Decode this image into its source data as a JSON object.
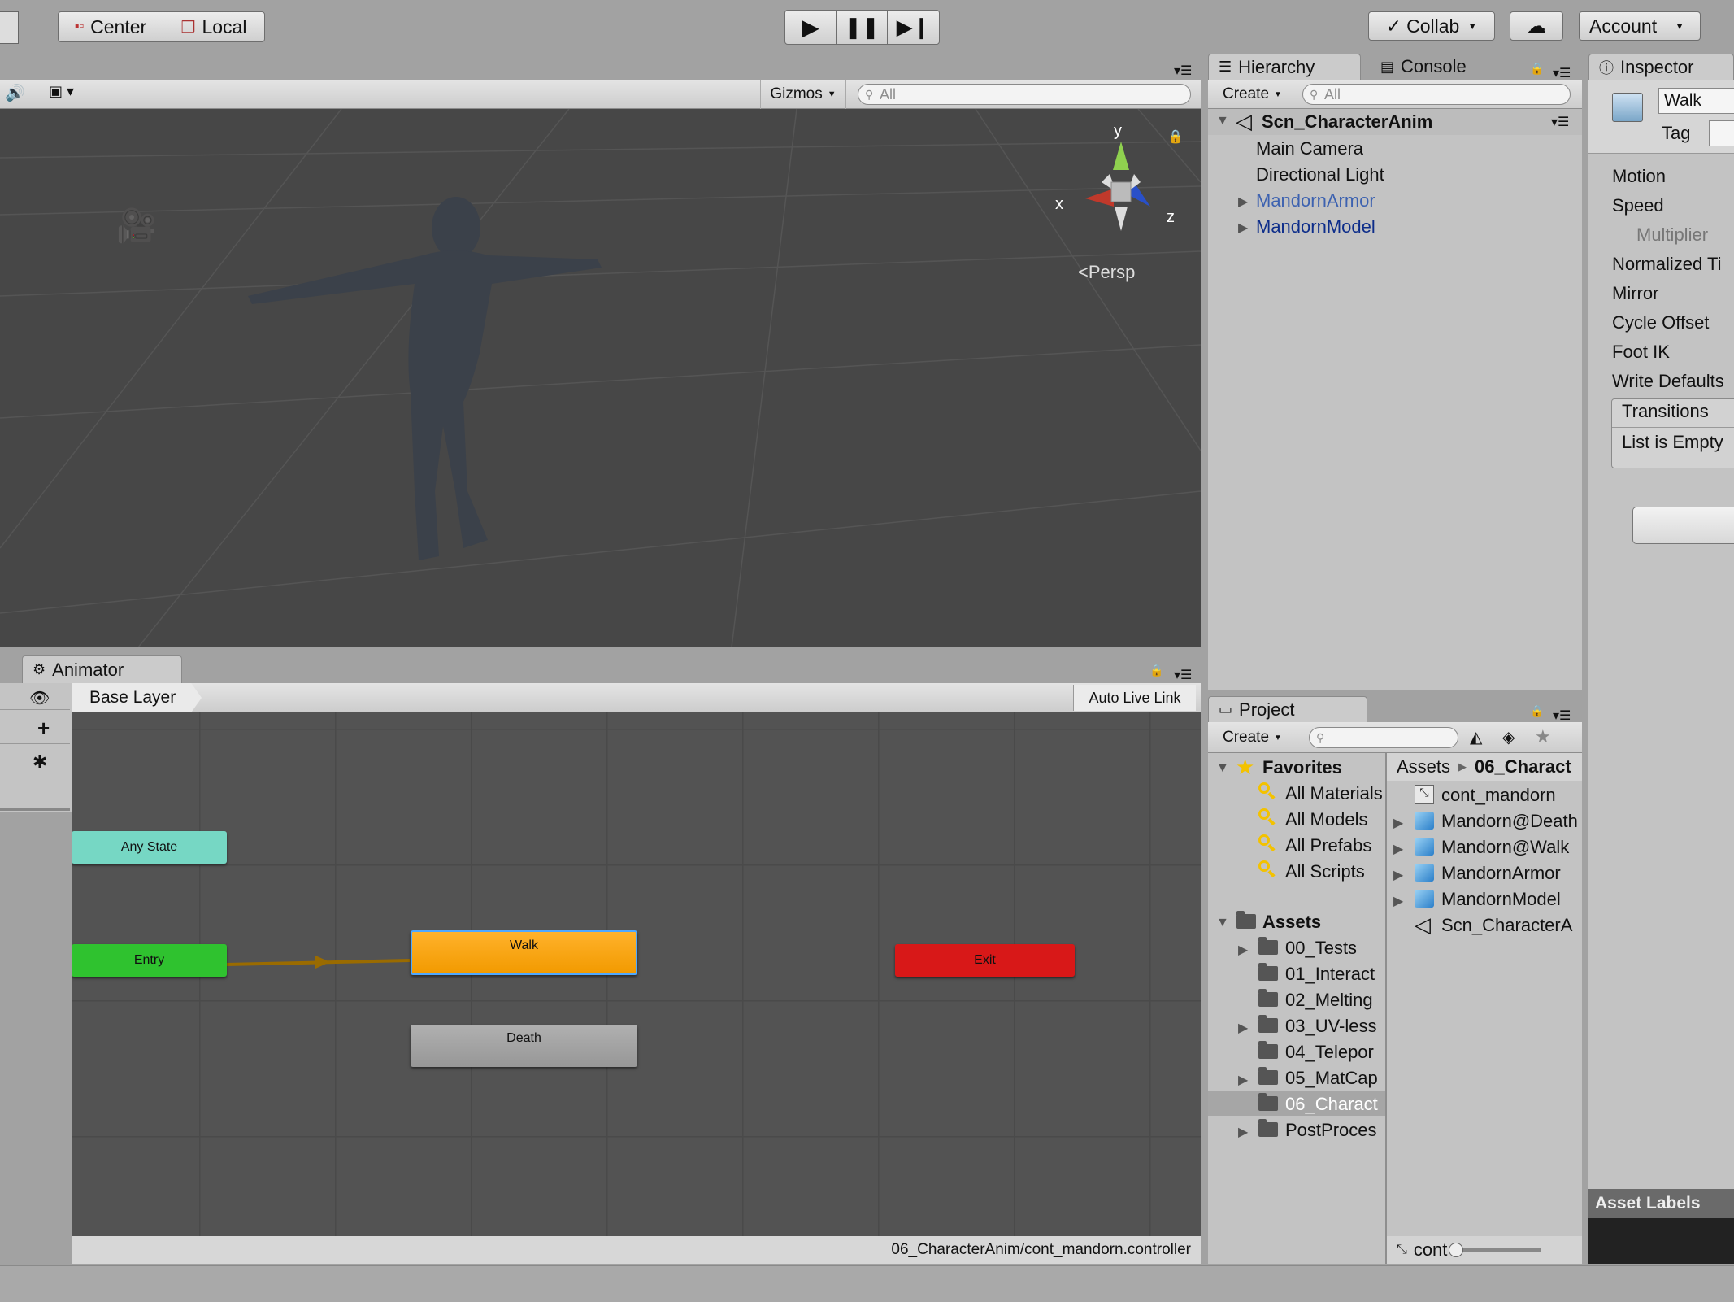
{
  "toolbar": {
    "center_label": "Center",
    "local_label": "Local",
    "collab_label": "Collab",
    "account_label": "Account"
  },
  "scene": {
    "gizmos_label": "Gizmos",
    "search_placeholder": "All",
    "persp_label": "Persp",
    "axis_x": "x",
    "axis_y": "y",
    "axis_z": "z"
  },
  "hierarchy": {
    "tab_label": "Hierarchy",
    "console_tab": "Console",
    "create_label": "Create",
    "search_placeholder": "All",
    "scene_name": "Scn_CharacterAnim",
    "items": [
      {
        "label": "Main Camera",
        "color": "#111111"
      },
      {
        "label": "Directional Light",
        "color": "#111111"
      },
      {
        "label": "MandornArmor",
        "color": "#3d62b0"
      },
      {
        "label": "MandornModel",
        "color": "#0d2d8a"
      }
    ]
  },
  "inspector": {
    "tab_label": "Inspector",
    "name_value": "Walk",
    "tag_label": "Tag",
    "fields": [
      "Motion",
      "Speed",
      "Multiplier",
      "Normalized Ti",
      "Mirror",
      "Cycle Offset",
      "Foot IK",
      "Write Defaults"
    ],
    "transitions_label": "Transitions",
    "list_empty_label": "List is Empty",
    "asset_labels": "Asset Labels"
  },
  "animator": {
    "tab_label": "Animator",
    "layer_label": "Base Layer",
    "auto_live_link": "Auto Live Link",
    "path": "06_CharacterAnim/cont_mandorn.controller",
    "nodes": {
      "any_state": "Any State",
      "entry": "Entry",
      "walk": "Walk",
      "exit": "Exit",
      "death": "Death"
    }
  },
  "project": {
    "tab_label": "Project",
    "create_label": "Create",
    "favorites_label": "Favorites",
    "favorites": [
      "All Materials",
      "All Models",
      "All Prefabs",
      "All Scripts"
    ],
    "assets_label": "Assets",
    "folders": [
      "00_Tests",
      "01_Interact",
      "02_Melting",
      "03_UV-less",
      "04_Telepor",
      "05_MatCap",
      "06_Charact",
      "PostProces"
    ],
    "breadcrumb_root": "Assets",
    "breadcrumb_current": "06_Charact",
    "files": [
      "cont_mandorn",
      "Mandorn@Death",
      "Mandorn@Walk",
      "MandornArmor",
      "MandornModel",
      "Scn_CharacterA"
    ],
    "footer_label": "cont"
  },
  "colors": {
    "accent_selection": "#3c82e6",
    "walk_node": "#f2a00a",
    "entry_node": "#2fc22f",
    "exit_node": "#d81818",
    "any_state_node": "#76d7c4",
    "death_node": "#9a9a9a"
  }
}
